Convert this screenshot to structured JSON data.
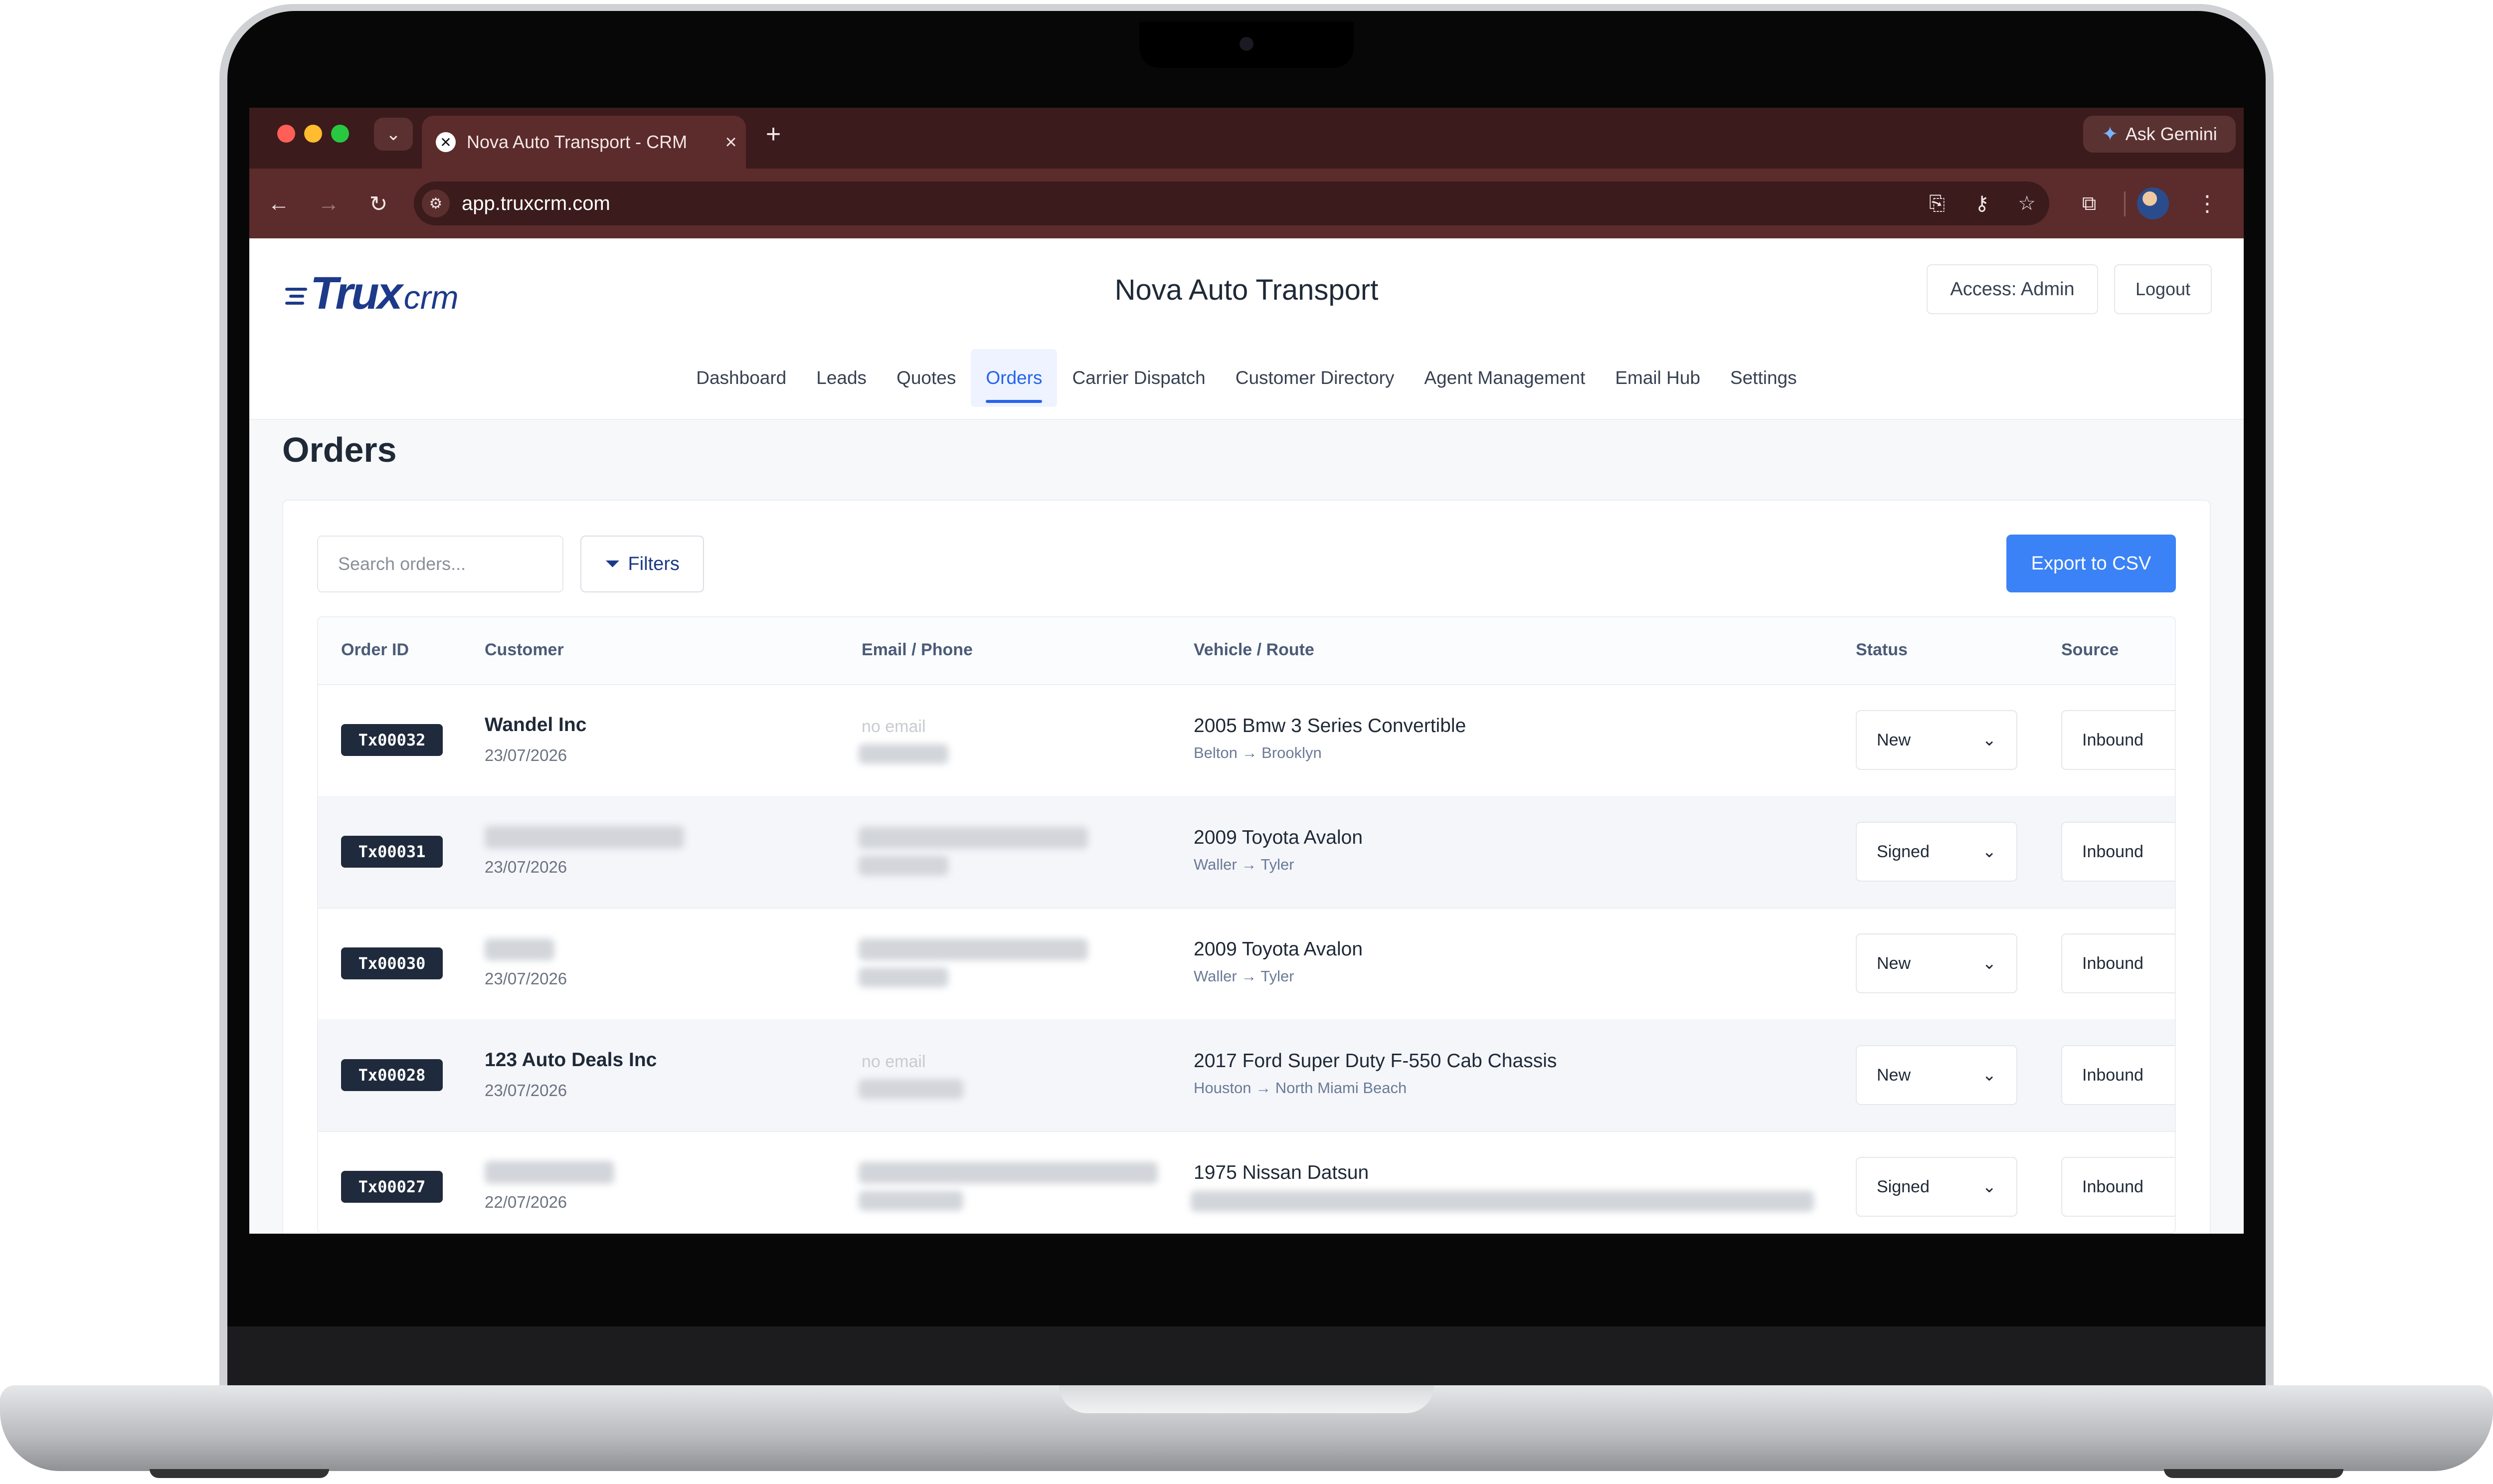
{
  "browser": {
    "tab_title": "Nova Auto Transport - CRM",
    "url": "app.truxcrm.com",
    "gemini_label": "Ask Gemini",
    "icons": [
      "tab-dropdown-icon",
      "close-icon",
      "plus-icon",
      "back-icon",
      "forward-icon",
      "reload-icon",
      "site-info-icon",
      "install-icon",
      "password-key-icon",
      "bookmark-star-icon",
      "extensions-icon",
      "kebab-menu-icon"
    ]
  },
  "app": {
    "logo_truck": "Trux",
    "logo_crm": "crm",
    "company_title": "Nova Auto Transport",
    "access_label": "Access: Admin",
    "logout_label": "Logout",
    "accent_color": "#3b82f6",
    "brand_color": "#1d3a8a"
  },
  "nav": {
    "items": [
      {
        "label": "Dashboard",
        "active": false
      },
      {
        "label": "Leads",
        "active": false
      },
      {
        "label": "Quotes",
        "active": false
      },
      {
        "label": "Orders",
        "active": true
      },
      {
        "label": "Carrier Dispatch",
        "active": false
      },
      {
        "label": "Customer Directory",
        "active": false
      },
      {
        "label": "Agent Management",
        "active": false
      },
      {
        "label": "Email Hub",
        "active": false
      },
      {
        "label": "Settings",
        "active": false
      }
    ]
  },
  "orders": {
    "title": "Orders",
    "search_placeholder": "Search orders...",
    "filters_label": "Filters",
    "export_label": "Export to CSV",
    "columns": {
      "order_id": "Order ID",
      "customer": "Customer",
      "email_phone": "Email / Phone",
      "vehicle_route": "Vehicle / Route",
      "status": "Status",
      "source": "Source"
    },
    "rows": [
      {
        "id": "Tx00032",
        "customer": "Wandel Inc",
        "date": "23/07/2026",
        "email": "no email",
        "vehicle": "2005 Bmw 3 Series Convertible",
        "route": "Belton → Brooklyn",
        "status": "New",
        "source": "Inbound"
      },
      {
        "id": "Tx00031",
        "customer": "",
        "date": "23/07/2026",
        "email": "",
        "vehicle": "2009 Toyota Avalon",
        "route": "Waller → Tyler",
        "status": "Signed",
        "source": "Inbound"
      },
      {
        "id": "Tx00030",
        "customer": "",
        "date": "23/07/2026",
        "email": "",
        "vehicle": "2009 Toyota Avalon",
        "route": "Waller → Tyler",
        "status": "New",
        "source": "Inbound"
      },
      {
        "id": "Tx00028",
        "customer": "123 Auto Deals Inc",
        "date": "23/07/2026",
        "email": "no email",
        "vehicle": "2017 Ford Super Duty F-550 Cab Chassis",
        "route": "Houston → North Miami Beach",
        "status": "New",
        "source": "Inbound"
      },
      {
        "id": "Tx00027",
        "customer": "",
        "date": "22/07/2026",
        "email": "",
        "vehicle": "1975 Nissan Datsun",
        "route": "",
        "status": "Signed",
        "source": "Inbound"
      }
    ]
  }
}
